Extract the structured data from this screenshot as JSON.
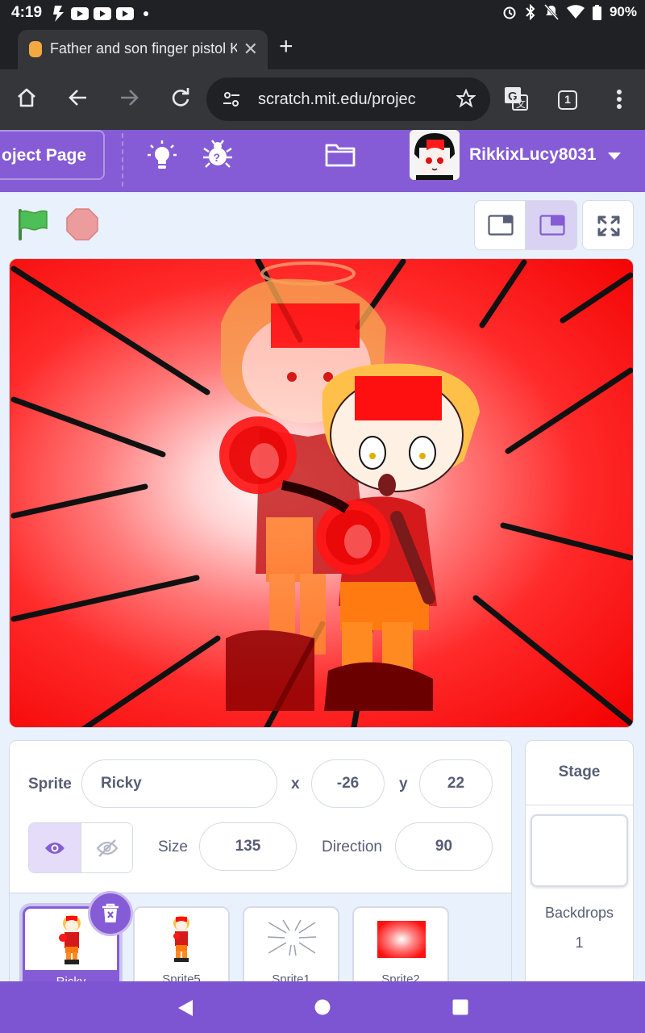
{
  "status_bar": {
    "time": "4:19",
    "battery": "90%"
  },
  "browser": {
    "tab_title": "Father and son finger pistol K",
    "url": "scratch.mit.edu/projec",
    "tab_count": "1"
  },
  "scratch_menu": {
    "project_page_label": "oject Page",
    "username": "RikkixLucy8031"
  },
  "sprite_info": {
    "sprite_label": "Sprite",
    "sprite_name": "Ricky",
    "x_label": "x",
    "x_value": "-26",
    "y_label": "y",
    "y_value": "22",
    "size_label": "Size",
    "size_value": "135",
    "direction_label": "Direction",
    "direction_value": "90"
  },
  "sprites": [
    {
      "name": "Ricky"
    },
    {
      "name": "Sprite5"
    },
    {
      "name": "Sprite1"
    },
    {
      "name": "Sprite2"
    }
  ],
  "stage_panel": {
    "title": "Stage",
    "backdrops_label": "Backdrops",
    "backdrops_count": "1"
  },
  "colors": {
    "scratch_purple": "#855cd6",
    "stage_red": "#ff0000",
    "flag_green": "#4cbf56"
  }
}
